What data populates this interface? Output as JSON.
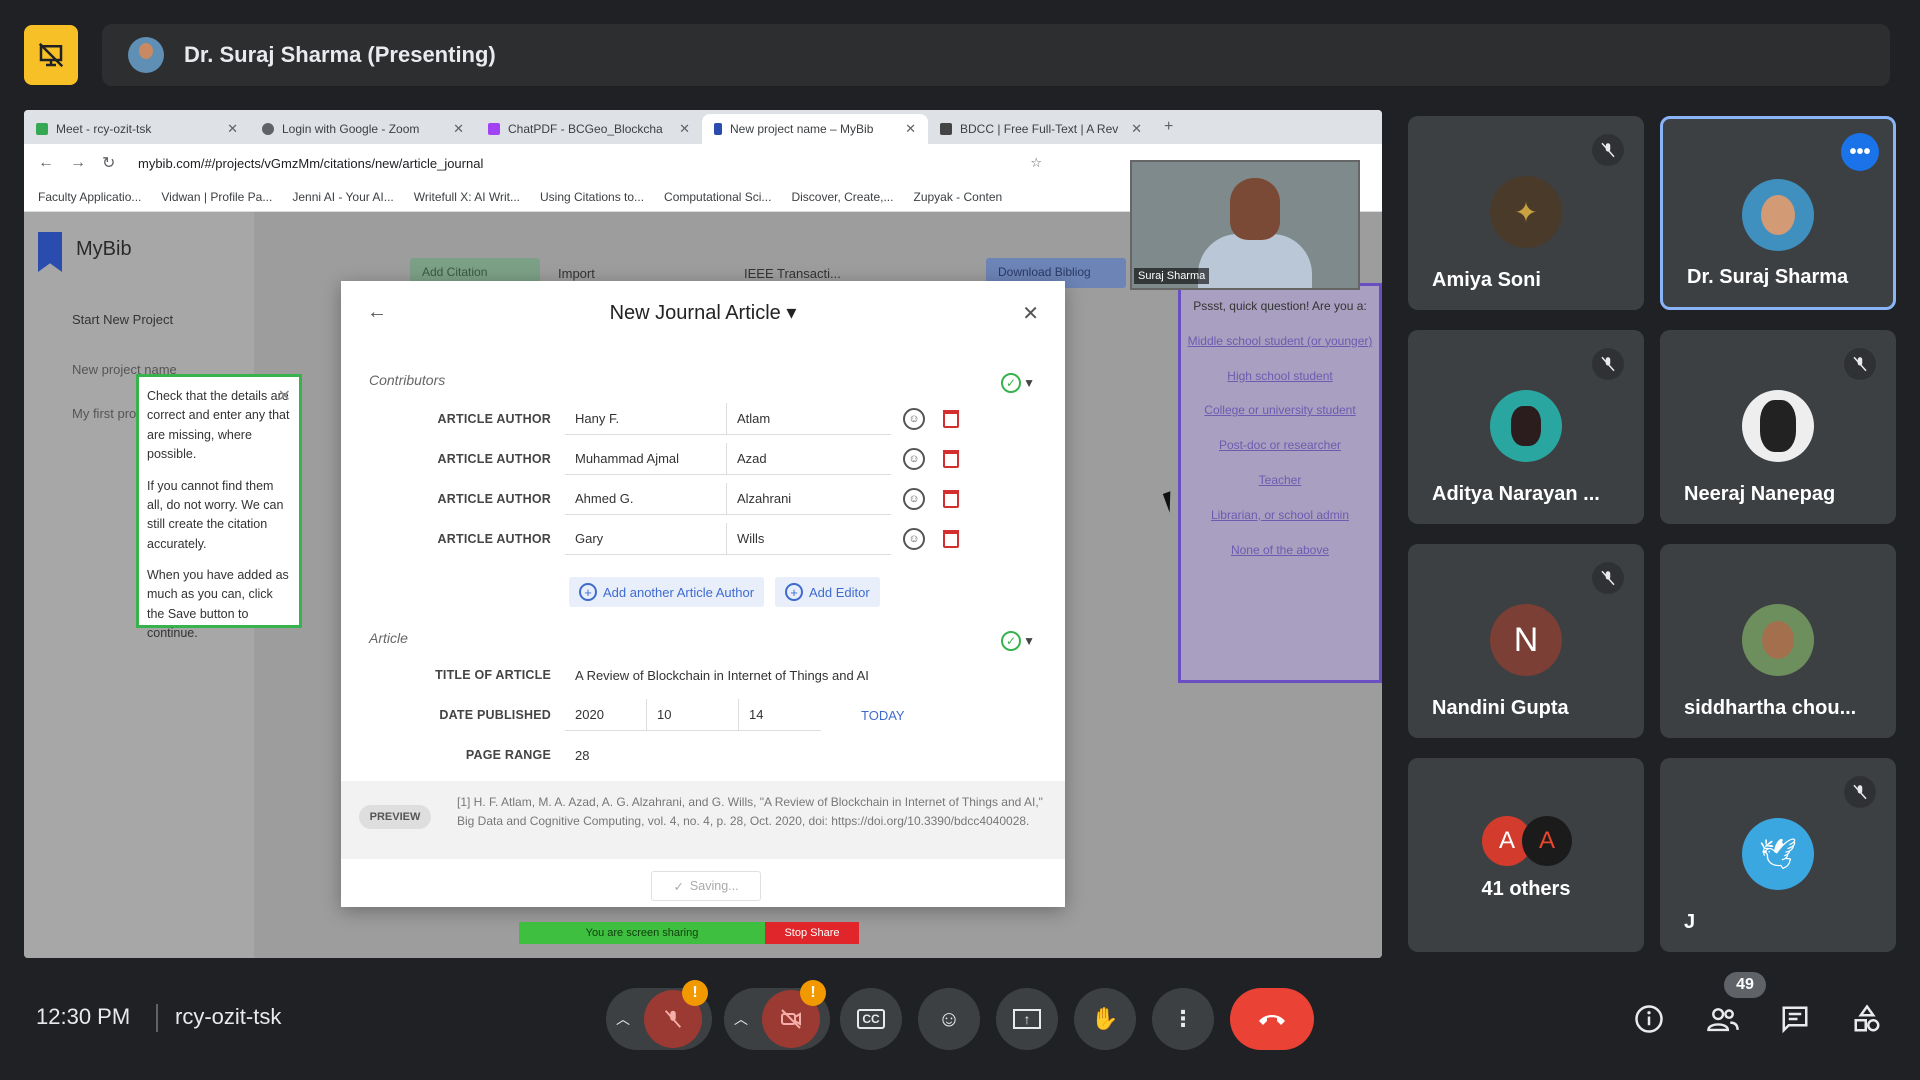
{
  "header": {
    "presenter_label": "Dr. Suraj Sharma (Presenting)"
  },
  "browser": {
    "tabs": [
      {
        "title": "Meet - rcy-ozit-tsk",
        "color": "#34a853"
      },
      {
        "title": "Login with Google - Zoom",
        "color": "#5f6368"
      },
      {
        "title": "ChatPDF - BCGeo_Blockcha",
        "color": "#a142f4"
      },
      {
        "title": "New project name – MyBib",
        "color": "#2b4caf"
      },
      {
        "title": "BDCC | Free Full-Text | A Rev",
        "color": "#444"
      }
    ],
    "url": "mybib.com/#/projects/vGmzMm/citations/new/article_journal",
    "bookmarks": [
      "Faculty Applicatio...",
      "Vidwan | Profile Pa...",
      "Jenni AI - Your AI...",
      "Writefull X: AI Writ...",
      "Using Citations to...",
      "Computational Sci...",
      "Discover, Create,...",
      "Zupyak - Conten"
    ]
  },
  "mybib": {
    "logo": "MyBib",
    "start_new": "Start New Project",
    "project_1": "New project name",
    "project_2": "My first project",
    "toolbar_add": "Add Citation",
    "toolbar_import": "Import",
    "toolbar_style": "IEEE Transacti...",
    "toolbar_download": "Download Bibliog"
  },
  "tooltip": {
    "p1": "Check that the details are correct and enter any that are missing, where possible.",
    "p2": "If you cannot find them all, do not worry. We can still create the citation accurately.",
    "p3": "When you have added as much as you can, click the Save button to continue."
  },
  "modal": {
    "title": "New Journal Article",
    "contributors_label": "Contributors",
    "authors": [
      {
        "label": "ARTICLE AUTHOR",
        "first": "Hany F.",
        "last": "Atlam"
      },
      {
        "label": "ARTICLE AUTHOR",
        "first": "Muhammad Ajmal",
        "last": "Azad"
      },
      {
        "label": "ARTICLE AUTHOR",
        "first": "Ahmed G.",
        "last": "Alzahrani"
      },
      {
        "label": "ARTICLE AUTHOR",
        "first": "Gary",
        "last": "Wills"
      }
    ],
    "add_author": "Add another Article Author",
    "add_editor": "Add Editor",
    "article_label": "Article",
    "title_label": "TITLE OF ARTICLE",
    "title_value": "A Review of Blockchain in Internet of Things and AI",
    "date_label": "DATE PUBLISHED",
    "date_year": "2020",
    "date_month": "10",
    "date_day": "14",
    "today": "TODAY",
    "page_label": "PAGE RANGE",
    "page_value": "28",
    "preview_chip": "PREVIEW",
    "preview_text": "[1]    H. F. Atlam, M. A. Azad, A. G. Alzahrani, and G. Wills, \"A Review of Blockchain in Internet of Things and AI,\" Big Data and Cognitive Computing, vol. 4, no. 4, p. 28, Oct. 2020, doi: https://doi.org/10.3390/bdcc4040028.",
    "saving": "Saving..."
  },
  "survey": {
    "question": "Pssst, quick question! Are you a:",
    "options": [
      "Middle school student (or younger)",
      "High school student",
      "College or university student",
      "Post-doc or researcher",
      "Teacher",
      "Librarian, or school admin",
      "None of the above"
    ]
  },
  "self_view_label": "Suraj Sharma",
  "share_bar": {
    "sharing": "You are screen sharing",
    "stop": "Stop Share"
  },
  "participants": [
    {
      "name": "Amiya Soni",
      "muted": true
    },
    {
      "name": "Dr. Suraj Sharma",
      "muted": false
    },
    {
      "name": "Aditya Narayan ...",
      "muted": true
    },
    {
      "name": "Neeraj Nanepag",
      "muted": true
    },
    {
      "name": "Nandini Gupta",
      "muted": true,
      "initial": "N"
    },
    {
      "name": "siddhartha chou...",
      "muted": false
    },
    {
      "name": "41 others",
      "initials": [
        "A",
        "A"
      ]
    },
    {
      "name": "J",
      "muted": true
    }
  ],
  "footer": {
    "time": "12:30 PM",
    "meeting_code": "rcy-ozit-tsk",
    "people_count": "49"
  },
  "colors": {
    "meet_bg": "#202124",
    "tile_bg": "#3c4043",
    "accent_blue": "#8ab4f8",
    "end_call_red": "#ea4335",
    "warning_yellow": "#f6c026"
  }
}
